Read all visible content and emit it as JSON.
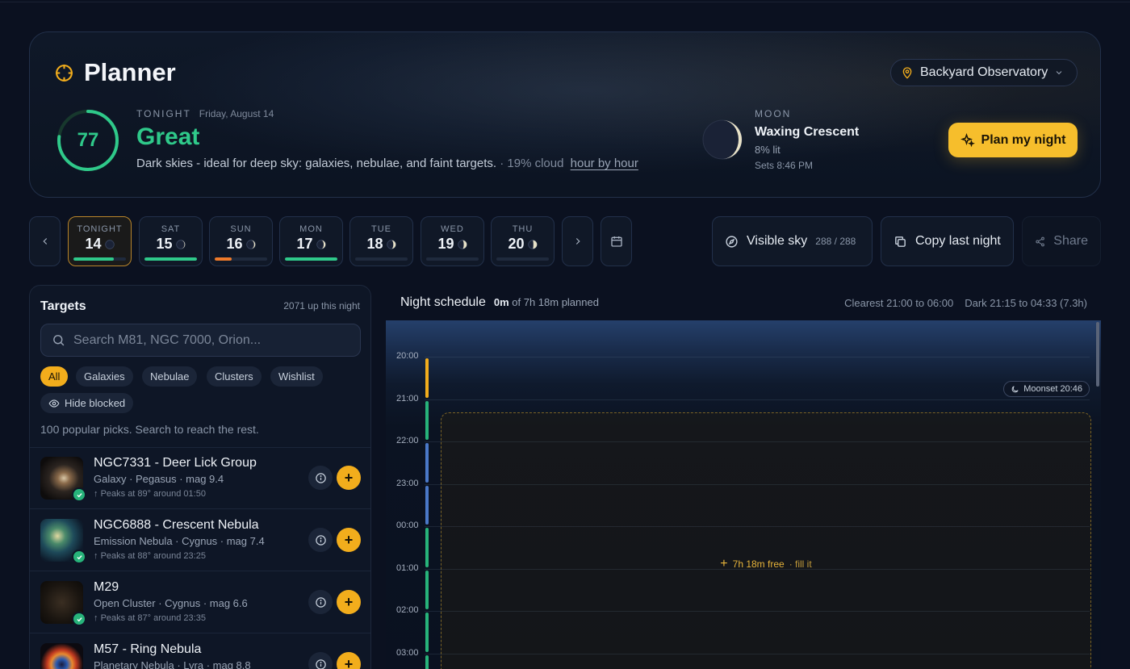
{
  "hero": {
    "title": "Planner",
    "tonight_label": "TONIGHT",
    "date": "Friday, August 14",
    "score": "77",
    "score_fraction": 0.77,
    "rating": "Great",
    "description": "Dark skies - ideal for deep sky: galaxies, nebulae, and faint targets.",
    "cloud": "· 19% cloud",
    "hourly_link": "hour by hour",
    "location": "Backyard Observatory",
    "moon_label": "MOON",
    "moon_phase": "Waxing Crescent",
    "moon_lit": "8% lit",
    "moon_sets": "Sets 8:46 PM",
    "plan_button": "Plan my night"
  },
  "days": [
    {
      "name": "TONIGHT",
      "num": "14",
      "quality": 0.77,
      "color": "#2fc98a"
    },
    {
      "name": "SAT",
      "num": "15",
      "quality": 1.0,
      "color": "#2fc98a"
    },
    {
      "name": "SUN",
      "num": "16",
      "quality": 0.32,
      "color": "#ef7a2a"
    },
    {
      "name": "MON",
      "num": "17",
      "quality": 1.0,
      "color": "#2fc98a"
    },
    {
      "name": "TUE",
      "num": "18",
      "quality": 0,
      "color": "#2fc98a"
    },
    {
      "name": "WED",
      "num": "19",
      "quality": 0,
      "color": "#2fc98a"
    },
    {
      "name": "THU",
      "num": "20",
      "quality": 0,
      "color": "#2fc98a"
    }
  ],
  "toolbar": {
    "visible_sky": "Visible sky",
    "visible_count": "288 / 288",
    "copy": "Copy last night",
    "share": "Share"
  },
  "targets": {
    "title": "Targets",
    "count": "2071 up this night",
    "search_placeholder": "Search M81, NGC 7000, Orion...",
    "filters": [
      "All",
      "Galaxies",
      "Nebulae",
      "Clusters",
      "Wishlist"
    ],
    "hide_blocked": "Hide blocked",
    "note": "100 popular picks. Search to reach the rest.",
    "items": [
      {
        "name": "NGC7331 - Deer Lick Group",
        "sub": "Galaxy · Pegasus · mag 9.4",
        "peak": "Peaks at 89° around 01:50"
      },
      {
        "name": "NGC6888 - Crescent Nebula",
        "sub": "Emission Nebula · Cygnus · mag 7.4",
        "peak": "Peaks at 88° around 23:25"
      },
      {
        "name": "M29",
        "sub": "Open Cluster · Cygnus · mag 6.6",
        "peak": "Peaks at 87° around 23:35"
      },
      {
        "name": "M57 - Ring Nebula",
        "sub": "Planetary Nebula · Lyra · mag 8.8",
        "peak": ""
      }
    ]
  },
  "schedule": {
    "title": "Night schedule",
    "planned_value": "0m",
    "planned_rest": "of 7h 18m planned",
    "clearest": "Clearest 21:00 to 06:00",
    "dark": "Dark 21:15 to 04:33 (7.3h)",
    "hours": [
      "20:00",
      "21:00",
      "22:00",
      "23:00",
      "00:00",
      "01:00",
      "02:00",
      "03:00"
    ],
    "moonset": "Moonset 20:46",
    "free_label": "7h 18m free",
    "fill_label": "· fill it"
  }
}
